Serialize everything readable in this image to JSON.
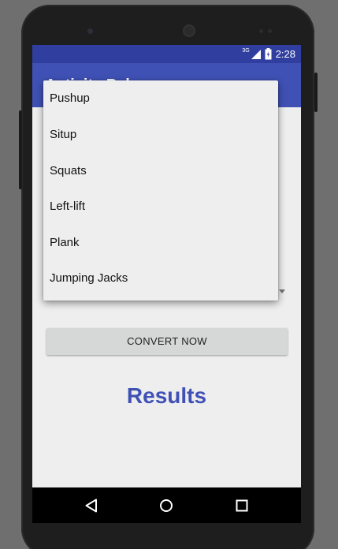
{
  "status_bar": {
    "network": "3G",
    "time": "2:28"
  },
  "app_bar": {
    "title": "Activity Pal"
  },
  "dropdown": {
    "items": [
      {
        "label": "Pushup"
      },
      {
        "label": "Situp"
      },
      {
        "label": "Squats"
      },
      {
        "label": "Left-lift"
      },
      {
        "label": "Plank"
      },
      {
        "label": "Jumping Jacks"
      }
    ]
  },
  "main": {
    "convert_button_label": "CONVERT NOW",
    "results_label": "Results"
  },
  "colors": {
    "primary": "#3f51b5",
    "primary_dark": "#303f9f",
    "background": "#eeeeee",
    "button_bg": "#d6d7d7"
  },
  "icons": {
    "signal": "signal-icon",
    "battery": "battery-icon",
    "back": "back-triangle-icon",
    "home": "home-circle-icon",
    "recents": "recents-square-icon"
  }
}
